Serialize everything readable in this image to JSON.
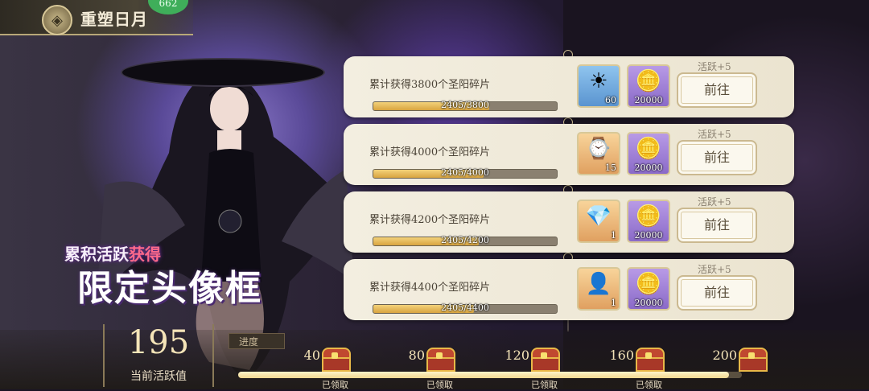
{
  "header": {
    "title": "重塑日月",
    "badge": "662"
  },
  "promo": {
    "subtitle_prefix": "累积活跃",
    "subtitle_highlight": "获得",
    "title": "限定头像框"
  },
  "tasks": [
    {
      "desc": "累计获得3800个圣阳碎片",
      "progress_text": "2405/3800",
      "progress": 0.633,
      "reward1": {
        "icon": "sun-medallion-icon",
        "count": "60",
        "color": "blue"
      },
      "reward2": {
        "icon": "gold-coin-icon",
        "count": "20000"
      },
      "active": "活跃+5",
      "button": "前往"
    },
    {
      "desc": "累计获得4000个圣阳碎片",
      "progress_text": "2405/4000",
      "progress": 0.601,
      "reward1": {
        "icon": "pocket-watch-icon",
        "count": "15",
        "color": "orange"
      },
      "reward2": {
        "icon": "gold-coin-icon",
        "count": "20000"
      },
      "active": "活跃+5",
      "button": "前往"
    },
    {
      "desc": "累计获得4200个圣阳碎片",
      "progress_text": "2405/4200",
      "progress": 0.573,
      "reward1": {
        "icon": "crystal-gem-icon",
        "count": "1",
        "color": "orange"
      },
      "reward2": {
        "icon": "gold-coin-icon",
        "count": "20000"
      },
      "active": "活跃+5",
      "button": "前往"
    },
    {
      "desc": "累计获得4400个圣阳碎片",
      "progress_text": "2405/4400",
      "progress": 0.547,
      "reward1": {
        "icon": "avatar-frame-icon",
        "count": "1",
        "color": "orange"
      },
      "reward2": {
        "icon": "gold-coin-icon",
        "count": "20000"
      },
      "active": "活跃+5",
      "button": "前往"
    }
  ],
  "bottom": {
    "score": "195",
    "score_label": "当前活跃值",
    "progress_tag": "进度",
    "progress": 0.975,
    "milestones": [
      {
        "value": "40",
        "status": "已领取"
      },
      {
        "value": "80",
        "status": "已领取"
      },
      {
        "value": "120",
        "status": "已领取"
      },
      {
        "value": "160",
        "status": "已领取"
      },
      {
        "value": "200",
        "status": ""
      }
    ]
  }
}
